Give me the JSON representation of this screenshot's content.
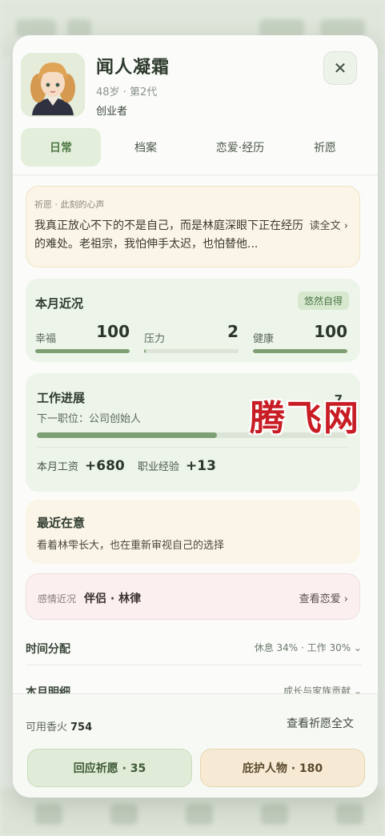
{
  "character": {
    "name": "闻人凝霜",
    "meta": "48岁 · 第2代",
    "role": "创业者"
  },
  "tabs": [
    {
      "label": "日常",
      "active": true
    },
    {
      "label": "档案",
      "active": false
    },
    {
      "label": "恋爱·经历",
      "active": false
    },
    {
      "label": "祈愿",
      "active": false
    }
  ],
  "wish": {
    "label": "祈愿 · 此刻的心声",
    "text": "我真正放心不下的不是自己，而是林庭深眼下正在经历的难处。老祖宗，我怕伸手太迟，也怕替他...",
    "link": "读全文 ›"
  },
  "month": {
    "title": "本月近况",
    "badge": "悠然自得",
    "stats": [
      {
        "label": "幸福",
        "value": "100",
        "fill": 1.0
      },
      {
        "label": "压力",
        "value": "2",
        "fill": 0.02
      },
      {
        "label": "健康",
        "value": "100",
        "fill": 1.0
      }
    ]
  },
  "work": {
    "title": "工作进展",
    "next": "下一职位：公司创始人",
    "percent_text": "7",
    "progress": 0.58,
    "salary_label": "本月工资",
    "salary_value": "+680",
    "exp_label": "职业经验",
    "exp_value": "+13"
  },
  "care": {
    "title": "最近在意",
    "text": "看着林雫长大，也在重新审视自己的选择"
  },
  "love": {
    "label": "感情近况",
    "partner": "伴侣 · 林律",
    "link": "查看恋爱 ›"
  },
  "rows": [
    {
      "title": "时间分配",
      "summary": "休息 34% · 工作 30% ⌄"
    },
    {
      "title": "本月明细",
      "summary": "成长与家族贡献 ⌄"
    }
  ],
  "footer": {
    "incense_label": "可用香火",
    "incense_value": "754",
    "view_wish": "查看祈愿全文",
    "respond_btn": "回应祈愿 · 35",
    "protect_btn": "庇护人物 · 180"
  },
  "watermark": "腾飞网",
  "colors": {
    "accent_green": "#7e9f73",
    "active_tab": "#4f7a47",
    "watermark_red": "#c81d24"
  }
}
